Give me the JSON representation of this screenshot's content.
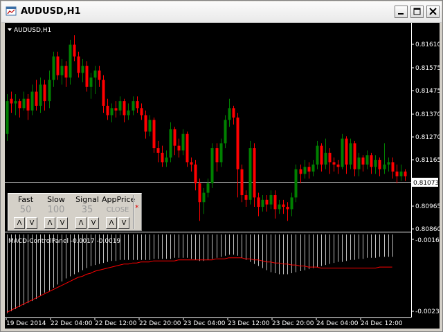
{
  "window": {
    "title": "AUDUSD,H1",
    "buttons": [
      "minimize",
      "maximize",
      "close"
    ]
  },
  "chart": {
    "symbol_label": "AUDUSD,H1",
    "price_axis": [
      "0.81610",
      "0.81575",
      "0.81475",
      "0.81370",
      "0.81270",
      "0.81165",
      "0.80965",
      "0.80860"
    ],
    "current_price": "0.81073",
    "time_axis": [
      "19 Dec 2014",
      "22 Dec 04:00",
      "22 Dec 12:00",
      "22 Dec 20:00",
      "23 Dec 04:00",
      "23 Dec 12:00",
      "23 Dec 20:00",
      "24 Dec 04:00",
      "24 Dec 12:00"
    ],
    "colors": {
      "bull": "#008000",
      "bear": "#ff0000",
      "background": "#000000",
      "grid": "#ffffff",
      "signal": "#ff0000",
      "histogram": "#c0c0c0"
    }
  },
  "indicator": {
    "label": "MACD-ControlPanel -0.0017 -0.0019",
    "axis_top": "-0.0016",
    "axis_bottom": "-0.0023"
  },
  "control_panel": {
    "fast": {
      "label": "Fast",
      "value": "50"
    },
    "slow": {
      "label": "Slow",
      "value": "100"
    },
    "signal": {
      "label": "Signal",
      "value": "35"
    },
    "appprice": {
      "label": "AppPrice",
      "value": "CLOSE"
    },
    "up_glyph": "Λ",
    "down_glyph": "V",
    "star": "*"
  },
  "chart_data": {
    "type": "candlestick",
    "price_ylim": [
      0.8084,
      0.8167
    ],
    "candles": [
      [
        0.8125,
        0.8139,
        0.8122,
        0.8142
      ],
      [
        0.814,
        0.8138,
        0.8134,
        0.8143
      ],
      [
        0.8138,
        0.8139,
        0.8133,
        0.8142
      ],
      [
        0.8139,
        0.8136,
        0.8132,
        0.814
      ],
      [
        0.8136,
        0.814,
        0.8135,
        0.8143
      ],
      [
        0.814,
        0.8135,
        0.8131,
        0.8142
      ],
      [
        0.8135,
        0.8143,
        0.8133,
        0.8146
      ],
      [
        0.8143,
        0.8137,
        0.8135,
        0.8148
      ],
      [
        0.8137,
        0.8146,
        0.8134,
        0.8149
      ],
      [
        0.8146,
        0.8139,
        0.8135,
        0.8148
      ],
      [
        0.8139,
        0.8148,
        0.8136,
        0.8152
      ],
      [
        0.8148,
        0.8158,
        0.8145,
        0.816
      ],
      [
        0.8158,
        0.815,
        0.8148,
        0.816
      ],
      [
        0.815,
        0.8154,
        0.8146,
        0.8157
      ],
      [
        0.8154,
        0.8149,
        0.8145,
        0.8156
      ],
      [
        0.8149,
        0.8163,
        0.8146,
        0.8165
      ],
      [
        0.8163,
        0.8158,
        0.8156,
        0.8167
      ],
      [
        0.8158,
        0.8151,
        0.8149,
        0.816
      ],
      [
        0.8151,
        0.8154,
        0.8147,
        0.8157
      ],
      [
        0.8154,
        0.8145,
        0.8143,
        0.8156
      ],
      [
        0.8145,
        0.8149,
        0.814,
        0.8151
      ],
      [
        0.8149,
        0.8152,
        0.8142,
        0.8154
      ],
      [
        0.8152,
        0.8148,
        0.8145,
        0.8154
      ],
      [
        0.8148,
        0.8137,
        0.8134,
        0.815
      ],
      [
        0.8137,
        0.8133,
        0.8131,
        0.814
      ],
      [
        0.8133,
        0.8136,
        0.813,
        0.8138
      ],
      [
        0.8136,
        0.8135,
        0.8132,
        0.8139
      ],
      [
        0.8135,
        0.8139,
        0.8133,
        0.8141
      ],
      [
        0.8139,
        0.8133,
        0.813,
        0.814
      ],
      [
        0.8133,
        0.8135,
        0.8131,
        0.8138
      ],
      [
        0.8135,
        0.8139,
        0.8133,
        0.8141
      ],
      [
        0.8139,
        0.8136,
        0.8134,
        0.8141
      ],
      [
        0.8136,
        0.8133,
        0.8131,
        0.8138
      ],
      [
        0.8133,
        0.8126,
        0.8123,
        0.8135
      ],
      [
        0.8126,
        0.8131,
        0.8124,
        0.8133
      ],
      [
        0.8131,
        0.8119,
        0.8117,
        0.8132
      ],
      [
        0.8119,
        0.8117,
        0.8113,
        0.8122
      ],
      [
        0.8117,
        0.8113,
        0.8111,
        0.812
      ],
      [
        0.8113,
        0.8115,
        0.8111,
        0.8118
      ],
      [
        0.8115,
        0.8127,
        0.8113,
        0.813
      ],
      [
        0.8127,
        0.812,
        0.8116,
        0.8128
      ],
      [
        0.812,
        0.8118,
        0.8115,
        0.8123
      ],
      [
        0.8118,
        0.8125,
        0.8116,
        0.8127
      ],
      [
        0.8125,
        0.8113,
        0.8111,
        0.8126
      ],
      [
        0.8113,
        0.8112,
        0.8109,
        0.8115
      ],
      [
        0.8112,
        0.8104,
        0.8101,
        0.8114
      ],
      [
        0.8104,
        0.8096,
        0.8088,
        0.8106
      ],
      [
        0.8096,
        0.81,
        0.8091,
        0.8102
      ],
      [
        0.81,
        0.8104,
        0.8098,
        0.8106
      ],
      [
        0.8104,
        0.8119,
        0.8102,
        0.8121
      ],
      [
        0.8119,
        0.8113,
        0.8109,
        0.8121
      ],
      [
        0.8113,
        0.8121,
        0.8111,
        0.8123
      ],
      [
        0.8121,
        0.8131,
        0.8119,
        0.8133
      ],
      [
        0.8131,
        0.8136,
        0.8128,
        0.814
      ],
      [
        0.8136,
        0.8132,
        0.8129,
        0.8137
      ],
      [
        0.8132,
        0.811,
        0.8098,
        0.8134
      ],
      [
        0.811,
        0.8099,
        0.8096,
        0.8112
      ],
      [
        0.8099,
        0.8097,
        0.8094,
        0.8101
      ],
      [
        0.8097,
        0.8119,
        0.8095,
        0.8122
      ],
      [
        0.8119,
        0.8098,
        0.8094,
        0.8121
      ],
      [
        0.8098,
        0.8094,
        0.809,
        0.81
      ],
      [
        0.8094,
        0.8097,
        0.8092,
        0.8099
      ],
      [
        0.8097,
        0.8095,
        0.8092,
        0.8099
      ],
      [
        0.8095,
        0.8099,
        0.8093,
        0.8101
      ],
      [
        0.8099,
        0.8093,
        0.8089,
        0.8101
      ],
      [
        0.8093,
        0.8095,
        0.8091,
        0.8097
      ],
      [
        0.8095,
        0.8094,
        0.8091,
        0.8097
      ],
      [
        0.8094,
        0.8093,
        0.8088,
        0.8096
      ],
      [
        0.8093,
        0.8098,
        0.809,
        0.81
      ],
      [
        0.8098,
        0.811,
        0.8096,
        0.8112
      ],
      [
        0.811,
        0.8108,
        0.8104,
        0.8112
      ],
      [
        0.8108,
        0.8111,
        0.8106,
        0.8114
      ],
      [
        0.8111,
        0.8109,
        0.8106,
        0.8113
      ],
      [
        0.8109,
        0.8112,
        0.8107,
        0.8114
      ],
      [
        0.8112,
        0.812,
        0.811,
        0.8122
      ],
      [
        0.812,
        0.8112,
        0.8109,
        0.8121
      ],
      [
        0.8112,
        0.8117,
        0.811,
        0.8123
      ],
      [
        0.8117,
        0.8113,
        0.8108,
        0.8119
      ],
      [
        0.8113,
        0.8112,
        0.8109,
        0.8115
      ],
      [
        0.8112,
        0.8111,
        0.8108,
        0.8114
      ],
      [
        0.8111,
        0.8123,
        0.811,
        0.8125
      ],
      [
        0.8123,
        0.8112,
        0.8108,
        0.8124
      ],
      [
        0.8112,
        0.8121,
        0.811,
        0.8123
      ],
      [
        0.8121,
        0.811,
        0.8107,
        0.8122
      ],
      [
        0.811,
        0.8115,
        0.8107,
        0.8117
      ],
      [
        0.8115,
        0.8112,
        0.8109,
        0.8116
      ],
      [
        0.8112,
        0.8116,
        0.811,
        0.8118
      ],
      [
        0.8116,
        0.8111,
        0.8108,
        0.8117
      ],
      [
        0.8111,
        0.8114,
        0.8108,
        0.8116
      ],
      [
        0.8114,
        0.811,
        0.8107,
        0.8115
      ],
      [
        0.811,
        0.8112,
        0.8108,
        0.8121
      ],
      [
        0.8112,
        0.8113,
        0.8109,
        0.8115
      ],
      [
        0.8113,
        0.8109,
        0.8106,
        0.8115
      ],
      [
        0.8109,
        0.8107,
        0.8104,
        0.8112
      ],
      [
        0.8107,
        0.8109,
        0.8105,
        0.8112
      ],
      [
        0.8109,
        0.8107,
        0.8105,
        0.811
      ]
    ],
    "macd_ylim": [
      -0.0023,
      -0.0016
    ],
    "macd_histogram_bottoms": [
      -0.00232,
      -0.0023,
      -0.00228,
      -0.00226,
      -0.00224,
      -0.00222,
      -0.0022,
      -0.00218,
      -0.00215,
      -0.00212,
      -0.0021,
      -0.00207,
      -0.00204,
      -0.00201,
      -0.00198,
      -0.00196,
      -0.00194,
      -0.00192,
      -0.0019,
      -0.00188,
      -0.00186,
      -0.00185,
      -0.00184,
      -0.00183,
      -0.00182,
      -0.00181,
      -0.00181,
      -0.0018,
      -0.0018,
      -0.0018,
      -0.0018,
      -0.0018,
      -0.0018,
      -0.0018,
      -0.0018,
      -0.00179,
      -0.00179,
      -0.00179,
      -0.00179,
      -0.00179,
      -0.00178,
      -0.00178,
      -0.00178,
      -0.00178,
      -0.00179,
      -0.0018,
      -0.00181,
      -0.00181,
      -0.0018,
      -0.00179,
      -0.00178,
      -0.00177,
      -0.00176,
      -0.00175,
      -0.00175,
      -0.00176,
      -0.00178,
      -0.0018,
      -0.00182,
      -0.00184,
      -0.00186,
      -0.00188,
      -0.0019,
      -0.00192,
      -0.00193,
      -0.00194,
      -0.00194,
      -0.00194,
      -0.00193,
      -0.00192,
      -0.00191,
      -0.0019,
      -0.00189,
      -0.00188,
      -0.00187,
      -0.00186,
      -0.00185,
      -0.00184,
      -0.00183,
      -0.00182,
      -0.00182,
      -0.00181,
      -0.0018,
      -0.0018,
      -0.00179,
      -0.00179,
      -0.00178,
      -0.00178,
      -0.00178,
      -0.00177,
      -0.00177,
      -0.00177,
      -0.00177
    ],
    "macd_signal": [
      -0.00231,
      -0.00229,
      -0.00227,
      -0.00225,
      -0.00223,
      -0.00221,
      -0.00219,
      -0.00217,
      -0.00215,
      -0.00213,
      -0.00211,
      -0.00209,
      -0.00207,
      -0.00205,
      -0.00203,
      -0.00201,
      -0.00199,
      -0.00197,
      -0.00196,
      -0.00194,
      -0.00193,
      -0.00191,
      -0.0019,
      -0.00189,
      -0.00188,
      -0.00187,
      -0.00186,
      -0.00185,
      -0.00184,
      -0.00184,
      -0.00183,
      -0.00183,
      -0.00182,
      -0.00182,
      -0.00182,
      -0.00181,
      -0.00181,
      -0.00181,
      -0.00181,
      -0.00181,
      -0.00181,
      -0.0018,
      -0.0018,
      -0.0018,
      -0.0018,
      -0.0018,
      -0.0018,
      -0.0018,
      -0.0018,
      -0.0018,
      -0.00179,
      -0.00179,
      -0.00179,
      -0.00178,
      -0.00178,
      -0.00178,
      -0.00178,
      -0.00179,
      -0.00179,
      -0.0018,
      -0.0018,
      -0.00181,
      -0.00182,
      -0.00182,
      -0.00183,
      -0.00183,
      -0.00184,
      -0.00184,
      -0.00185,
      -0.00185,
      -0.00186,
      -0.00186,
      -0.00187,
      -0.00187,
      -0.00187,
      -0.00188,
      -0.00188,
      -0.00188,
      -0.00188,
      -0.00188,
      -0.00188,
      -0.00188,
      -0.00188,
      -0.00188,
      -0.00188,
      -0.00188,
      -0.00188,
      -0.00188,
      -0.00188,
      -0.00187,
      -0.00187,
      -0.00187,
      -0.00187
    ]
  }
}
